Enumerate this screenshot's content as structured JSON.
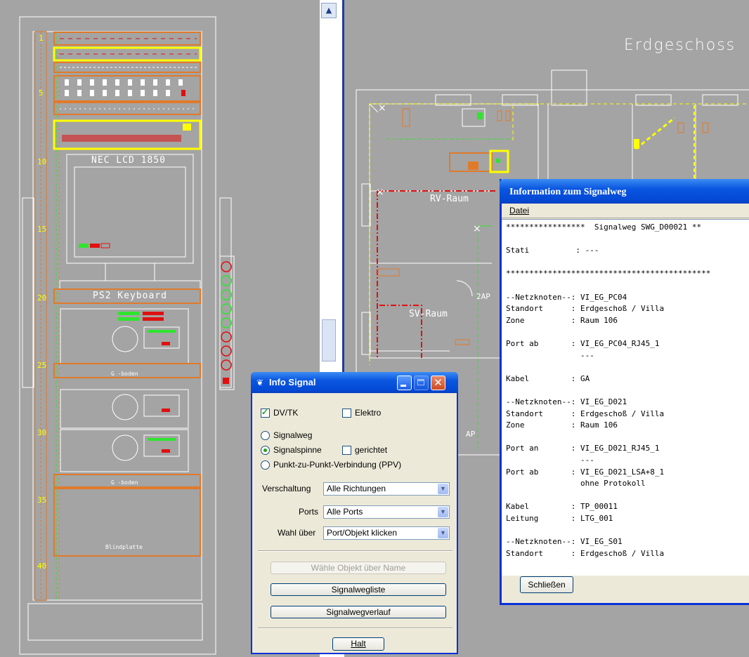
{
  "rack": {
    "monitor_label": "NEC LCD 1850",
    "keyboard_label": "PS2 Keyboard",
    "unit_numbers": [
      "1",
      "5",
      "10",
      "15",
      "20",
      "25",
      "30",
      "35",
      "40"
    ],
    "shelf1_label": "G -boden",
    "shelf2_label": "G -boden",
    "blank_label": "Blindplatte"
  },
  "floorplan": {
    "title": "Erdgeschoss",
    "room_rv": "RV-Raum",
    "room_sv": "SV-Raum",
    "label_2ap": "2AP",
    "label_ap": "AP"
  },
  "info_signal": {
    "title": "Info Signal",
    "dvtk_label": "DV/TK",
    "elektro_label": "Elektro",
    "signalweg_label": "Signalweg",
    "signalspinne_label": "Signalspinne",
    "gerichtet_label": "gerichtet",
    "ppv_label": "Punkt-zu-Punkt-Verbindung (PPV)",
    "verschaltung_label": "Verschaltung",
    "verschaltung_value": "Alle Richtungen",
    "ports_label": "Ports",
    "ports_value": "Alle Ports",
    "wahl_label": "Wahl über",
    "wahl_value": "Port/Objekt klicken",
    "wahle_objekt_button": "Wähle Objekt über Name",
    "signalwegliste_button": "Signalwegliste",
    "signalwegverlauf_button": "Signalwegverlauf",
    "halt_button": "Halt"
  },
  "info_signalweg": {
    "title": "Information zum Signalweg",
    "menu_datei": "Datei",
    "lines": [
      "*****************  Signalweg SWG_D00021 **",
      "",
      "Stati          : ---",
      "",
      "********************************************",
      "",
      "--Netzknoten--: VI_EG_PC04",
      "Standort      : Erdgeschoß / Villa",
      "Zone          : Raum 106",
      "",
      "Port ab       : VI_EG_PC04_RJ45_1",
      "                ---",
      "",
      "Kabel         : GA",
      "",
      "--Netzknoten--: VI_EG_D021",
      "Standort      : Erdgeschoß / Villa",
      "Zone          : Raum 106",
      "",
      "Port an       : VI_EG_D021_RJ45_1",
      "                ---",
      "Port ab       : VI_EG_D021_LSA+8_1",
      "                ohne Protokoll",
      "",
      "Kabel         : TP_00011",
      "Leitung       : LTG_001",
      "",
      "--Netzknoten--: VI_EG_S01",
      "Standort      : Erdgeschoß / Villa"
    ],
    "close_button": "Schließen"
  },
  "colors": {
    "cad_background": "#a4a4a4",
    "cad_orange": "#e07a2b",
    "cad_yellow": "#ffff00",
    "cad_green": "#2ee52e",
    "cad_red": "#e01010",
    "xp_title_blue": "#0a4fd6",
    "xp_face": "#ece9d8"
  }
}
